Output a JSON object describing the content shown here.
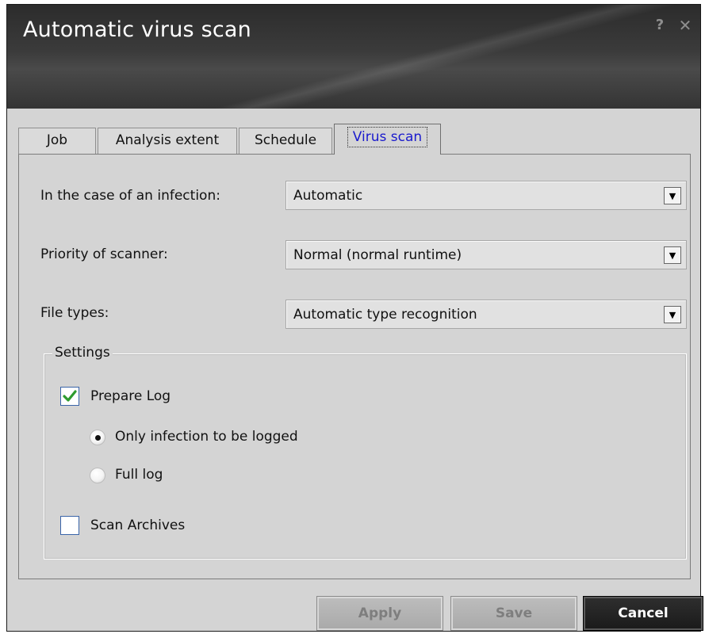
{
  "window": {
    "title": "Automatic virus scan",
    "help_glyph": "?",
    "close_glyph": "✕"
  },
  "tabs": [
    {
      "label": "Job",
      "active": false
    },
    {
      "label": "Analysis extent",
      "active": false
    },
    {
      "label": "Schedule",
      "active": false
    },
    {
      "label": "Virus scan",
      "active": true
    }
  ],
  "form": {
    "infection": {
      "label": "In the case of an infection:",
      "value": "Automatic"
    },
    "priority": {
      "label": "Priority of scanner:",
      "value": "Normal (normal runtime)"
    },
    "file_types": {
      "label": "File types:",
      "value": "Automatic type recognition"
    }
  },
  "settings": {
    "legend": "Settings",
    "prepare_log": {
      "label": "Prepare Log",
      "checked": true
    },
    "only_infection": {
      "label": "Only infection to be logged",
      "selected": true
    },
    "full_log": {
      "label": "Full log",
      "selected": false
    },
    "scan_archives": {
      "label": "Scan Archives",
      "checked": false
    }
  },
  "buttons": {
    "apply": "Apply",
    "save": "Save",
    "cancel": "Cancel"
  },
  "colors": {
    "active_tab_text": "#1a1acd",
    "checkmark": "#2e9b2e",
    "titlebar": "#3b3b3b",
    "dialog_bg": "#d4d4d4"
  },
  "icons": {
    "help": "help-icon",
    "close": "close-icon",
    "dropdown": "chevron-down-icon",
    "check": "checkmark-icon"
  }
}
